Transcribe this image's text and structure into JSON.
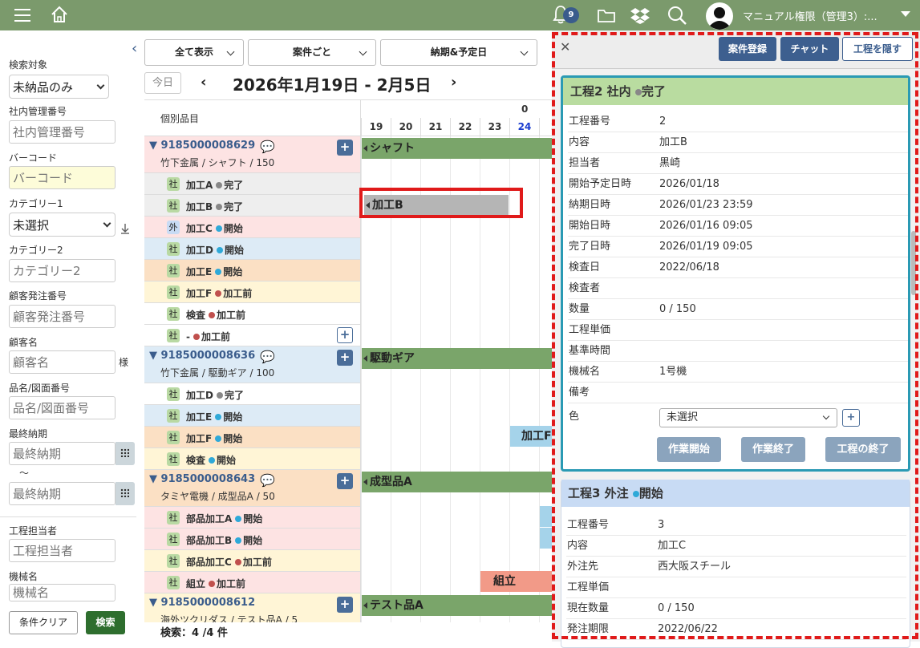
{
  "topbar": {
    "notif_count": "9",
    "user": "マニュアル権限（管理3）:..."
  },
  "sidebar": {
    "target_label": "検索対象",
    "target_value": "未納品のみ",
    "mgmt_label": "社内管理番号",
    "mgmt_ph": "社内管理番号",
    "barcode_label": "バーコード",
    "barcode_ph": "バーコード",
    "cat1_label": "カテゴリー1",
    "cat1_value": "未選択",
    "cat2_label": "カテゴリー2",
    "cat2_ph": "カテゴリー2",
    "order_label": "顧客発注番号",
    "order_ph": "顧客発注番号",
    "cust_label": "顧客名",
    "cust_ph": "顧客名",
    "sama": "様",
    "item_label": "品名/図面番号",
    "item_ph": "品名/図面番号",
    "due_label": "最終納期",
    "due_ph1": "最終納期",
    "tilde": "～",
    "due_ph2": "最終納期",
    "worker_label": "工程担当者",
    "worker_ph": "工程担当者",
    "machine_label": "機械名",
    "machine_ph": "機械名",
    "clear_btn": "条件クリア",
    "search_btn": "検索"
  },
  "filters": {
    "show_all": "全て表示",
    "by_case": "案件ごと",
    "by_due": "納期&予定日"
  },
  "nav": {
    "today": "今日",
    "range": "2026年1月19日 - 2月5日",
    "prev": "‹",
    "next": "›"
  },
  "gantt": {
    "col_head": "個別品目",
    "month_mark": "0",
    "days": [
      "19",
      "20",
      "21",
      "22",
      "23",
      "24",
      "2"
    ],
    "groups": [
      {
        "num": "▼ 9185000008629",
        "sub": "竹下金属 / シャフト / 150",
        "bar": "シャフト"
      },
      {
        "num": "▼ 9185000008636",
        "sub": "竹下金属 / 駆動ギア / 100",
        "bar": "駆動ギア"
      },
      {
        "num": "▼ 9185000008643",
        "sub": "タミヤ電機 / 成型品A / 50",
        "bar": "成型品A"
      },
      {
        "num": "▼ 9185000008612",
        "sub": "海外ツクリダス / テスト品A / 5",
        "bar": "テスト品A"
      }
    ],
    "procs": [
      {
        "tag": "社",
        "name": "加工A",
        "status": "完了"
      },
      {
        "tag": "社",
        "name": "加工B",
        "status": "完了"
      },
      {
        "tag": "外",
        "name": "加工C",
        "status": "開始"
      },
      {
        "tag": "社",
        "name": "加工D",
        "status": "開始"
      },
      {
        "tag": "社",
        "name": "加工E",
        "status": "開始"
      },
      {
        "tag": "社",
        "name": "加工F",
        "status": "加工前"
      },
      {
        "tag": "社",
        "name": "検査",
        "status": "加工前"
      },
      {
        "tag": "社",
        "name": "-",
        "status": "加工前"
      },
      {
        "tag": "社",
        "name": "加工D",
        "status": "完了"
      },
      {
        "tag": "社",
        "name": "加工E",
        "status": "開始"
      },
      {
        "tag": "社",
        "name": "加工F",
        "status": "開始"
      },
      {
        "tag": "社",
        "name": "検査",
        "status": "開始"
      },
      {
        "tag": "社",
        "name": "部品加工A",
        "status": "開始"
      },
      {
        "tag": "社",
        "name": "部品加工B",
        "status": "開始"
      },
      {
        "tag": "社",
        "name": "部品加工C",
        "status": "加工前"
      },
      {
        "tag": "社",
        "name": "組立",
        "status": "加工前"
      }
    ],
    "bar_kakoB": "加工B",
    "bar_kakoF": "加工F",
    "bar_kumitate": "組立",
    "count": "検索：4 /4 件"
  },
  "panel": {
    "close": "✕",
    "register": "案件登録",
    "chat": "チャット",
    "hide": "工程を隠す",
    "card1": {
      "title": "工程2 社内",
      "status": "完了",
      "rows": [
        [
          "工程番号",
          "2"
        ],
        [
          "内容",
          "加工B"
        ],
        [
          "担当者",
          "黒崎"
        ],
        [
          "開始予定日時",
          "2026/01/18"
        ],
        [
          "納期日時",
          "2026/01/23 23:59"
        ],
        [
          "開始日時",
          "2026/01/16 09:05"
        ],
        [
          "完了日時",
          "2026/01/19 09:05"
        ],
        [
          "検査日",
          "2022/06/18"
        ],
        [
          "検査者",
          ""
        ],
        [
          "数量",
          "0 / 150"
        ],
        [
          "工程単価",
          ""
        ],
        [
          "基準時間",
          ""
        ],
        [
          "機械名",
          "1号機"
        ],
        [
          "備考",
          ""
        ]
      ],
      "color_label": "色",
      "color_value": "未選択",
      "start": "作業開始",
      "end": "作業終了",
      "finish": "工程の終了"
    },
    "card2": {
      "title": "工程3 外注",
      "status": "開始",
      "rows": [
        [
          "工程番号",
          "3"
        ],
        [
          "内容",
          "加工C"
        ],
        [
          "外注先",
          "西大阪スチール"
        ],
        [
          "工程単価",
          ""
        ],
        [
          "現在数量",
          "0 / 150"
        ],
        [
          "発注期限",
          "2022/06/22"
        ]
      ]
    }
  },
  "colors": {
    "topbar": "#7b9a6c",
    "accent": "#3a5c8c",
    "done": "#888888",
    "started": "#2fa9d8",
    "before": "#c0504d",
    "highlight": "#e01a1a"
  }
}
